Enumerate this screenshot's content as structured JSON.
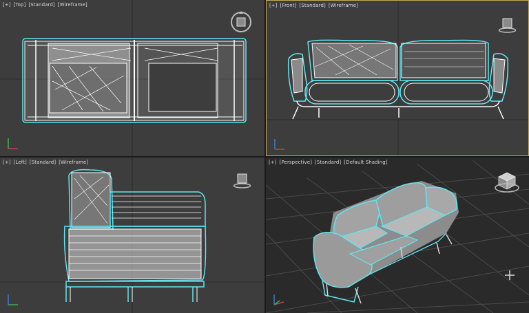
{
  "viewports": {
    "top": {
      "menu": "[+]",
      "view": "[Top]",
      "shading_mode": "[Standard]",
      "display": "[Wireframe]"
    },
    "front": {
      "menu": "[+]",
      "view": "[Front]",
      "shading_mode": "[Standard]",
      "display": "[Wireframe]"
    },
    "left": {
      "menu": "[+]",
      "view": "[Left]",
      "shading_mode": "[Standard]",
      "display": "[Wireframe]"
    },
    "persp": {
      "menu": "[+]",
      "view": "[Perspective]",
      "shading_mode": "[Standard]",
      "display": "[Default Shading]"
    }
  },
  "colors": {
    "viewport_bg": "#3d3d3d",
    "perspective_bg": "#2a2a2a",
    "active_border": "#c9a95a",
    "selection_outline": "#5fe6f0",
    "wire": "#ffffff",
    "label_text": "#d8d8d8"
  },
  "icons": {
    "viewcube": "view-cube-icon",
    "axis_tripod": "axis-tripod-icon",
    "pan": "pan-crosshair-icon"
  },
  "scene": {
    "object": "sofa",
    "selected": true
  }
}
